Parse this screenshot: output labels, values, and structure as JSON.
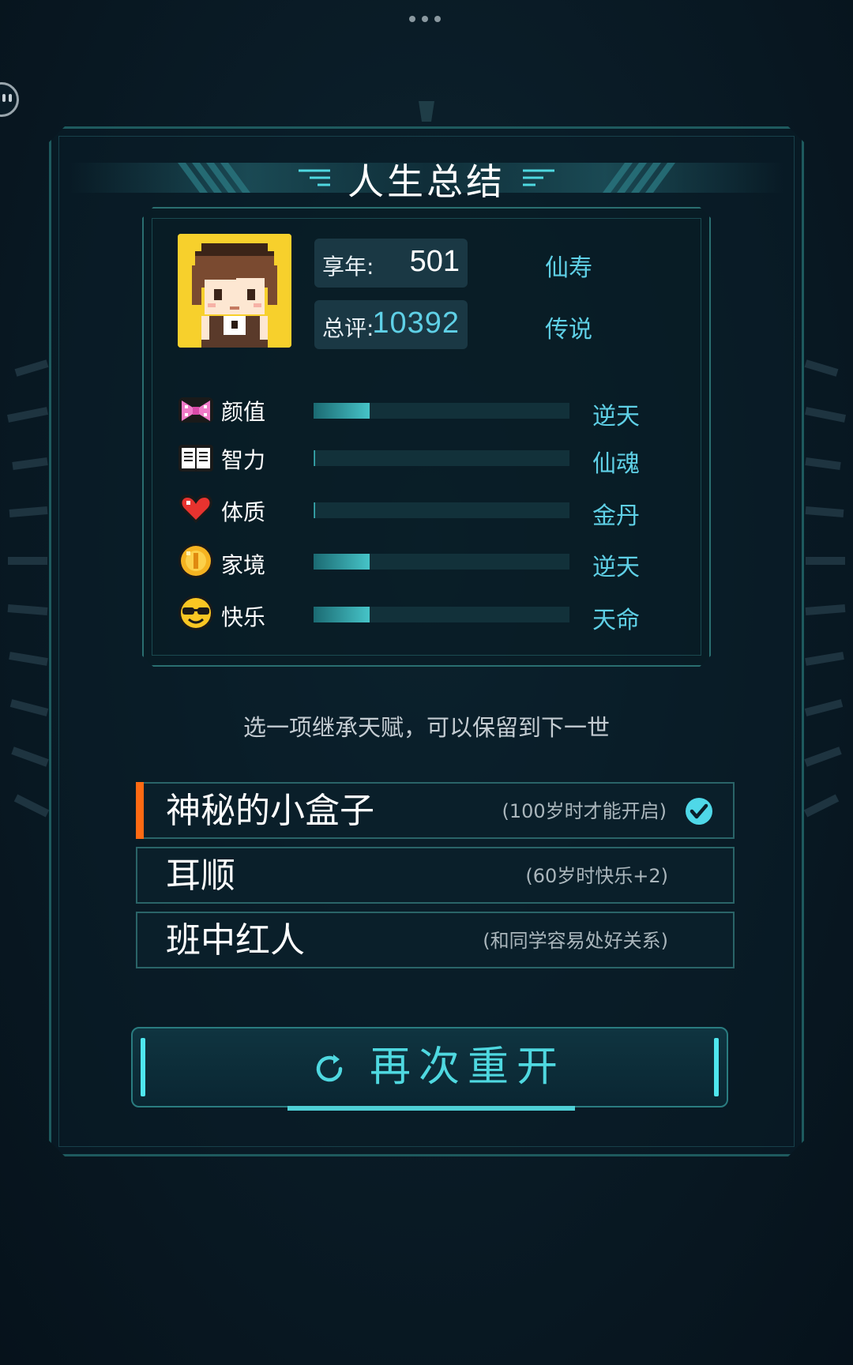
{
  "title": "人生总结",
  "summary": {
    "age_label": "享年:",
    "age_value": "501",
    "age_rank": "仙寿",
    "score_label": "总评:",
    "score_value": "10392",
    "score_rank": "传说"
  },
  "attributes": [
    {
      "icon": "bow-icon",
      "name": "颜值",
      "fill": 0.22,
      "grade": "逆天"
    },
    {
      "icon": "book-icon",
      "name": "智力",
      "fill": 0.005,
      "grade": "仙魂"
    },
    {
      "icon": "heart-icon",
      "name": "体质",
      "fill": 0.005,
      "grade": "金丹"
    },
    {
      "icon": "coin-icon",
      "name": "家境",
      "fill": 0.22,
      "grade": "逆天"
    },
    {
      "icon": "sunglasses-face-icon",
      "name": "快乐",
      "fill": 0.22,
      "grade": "天命"
    }
  ],
  "inherit_hint": "选一项继承天赋，可以保留到下一世",
  "talents": [
    {
      "name": "神秘的小盒子",
      "desc": "(100岁时才能开启)",
      "selected": true
    },
    {
      "name": "耳顺",
      "desc": "(60岁时快乐+2)",
      "selected": false
    },
    {
      "name": "班中红人",
      "desc": "(和同学容易处好关系)",
      "selected": false
    }
  ],
  "restart_label": "再次重开",
  "colors": {
    "accent": "#5fd0e6",
    "bar": "#46c4c8",
    "selected_marker": "#ff6a13",
    "avatar_bg": "#f7d02c"
  }
}
